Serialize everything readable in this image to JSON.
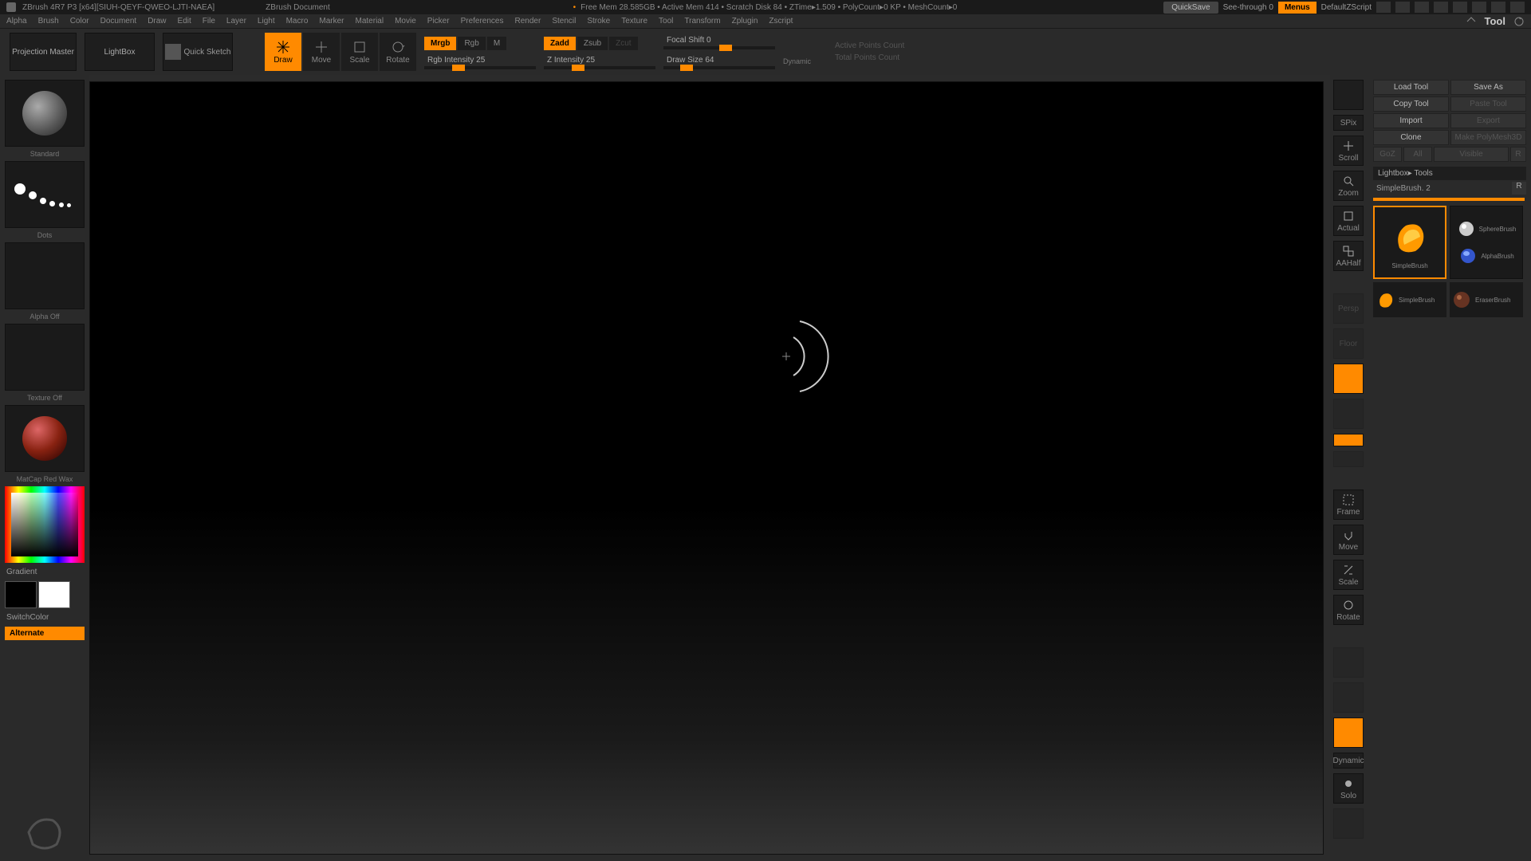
{
  "title": {
    "app": "ZBrush 4R7 P3 [x64][SIUH-QEYF-QWEO-LJTI-NAEA]",
    "doc": "ZBrush Document",
    "status": "Free Mem 28.585GB • Active Mem 414 • Scratch Disk 84 • ZTime▸1.509 • PolyCount▸0 KP • MeshCount▸0",
    "quicksave": "QuickSave",
    "seethrough": "See-through  0",
    "menus": "Menus",
    "defaultzscript": "DefaultZScript"
  },
  "menu": {
    "items": [
      "Alpha",
      "Brush",
      "Color",
      "Document",
      "Draw",
      "Edit",
      "File",
      "Layer",
      "Light",
      "Macro",
      "Marker",
      "Material",
      "Movie",
      "Picker",
      "Preferences",
      "Render",
      "Stencil",
      "Stroke",
      "Texture",
      "Tool",
      "Transform",
      "Zplugin",
      "Zscript"
    ],
    "tool_header": "Tool"
  },
  "toolbar": {
    "projection_master": "Projection Master",
    "lightbox": "LightBox",
    "quick_sketch": "Quick Sketch",
    "modes": {
      "draw": "Draw",
      "move": "Move",
      "scale": "Scale",
      "rotate": "Rotate"
    },
    "mrgb": "Mrgb",
    "rgb": "Rgb",
    "m": "M",
    "rgb_intensity": "Rgb Intensity 25",
    "zadd": "Zadd",
    "zsub": "Zsub",
    "zcut": "Zcut",
    "z_intensity": "Z Intensity 25",
    "focal_shift": "Focal Shift 0",
    "draw_size": "Draw Size 64",
    "dynamic": "Dynamic",
    "active_points": "Active Points Count",
    "total_points": "Total Points Count"
  },
  "left": {
    "brush_label": "Standard",
    "stroke_label": "Dots",
    "alpha_label": "Alpha Off",
    "texture_label": "Texture Off",
    "material_label": "MatCap Red Wax",
    "gradient": "Gradient",
    "switch_color": "SwitchColor",
    "alternate": "Alternate"
  },
  "shelf": {
    "spix": "SPix",
    "scroll": "Scroll",
    "zoom": "Zoom",
    "actual": "Actual",
    "aahalf": "AAHalf",
    "persp": "Persp",
    "floor": "Floor",
    "frame": "Frame",
    "move": "Move",
    "scale": "Scale",
    "rotate": "Rotate",
    "dynamic": "Dynamic",
    "solo": "Solo"
  },
  "tool": {
    "load": "Load Tool",
    "save_as": "Save As",
    "copy": "Copy Tool",
    "paste": "Paste Tool",
    "import": "Import",
    "export": "Export",
    "clone": "Clone",
    "make_polymesh": "Make PolyMesh3D",
    "goz": "GoZ",
    "all": "All",
    "visible": "Visible",
    "r": "R",
    "lightbox_tools": "Lightbox▸ Tools",
    "current": "SimpleBrush. 2",
    "r2": "R",
    "items": {
      "simplebrush": "SimpleBrush",
      "spherebrush": "SphereBrush",
      "alphabrush": "AlphaBrush",
      "simplebrush2": "SimpleBrush",
      "eraserbrush": "EraserBrush"
    }
  }
}
